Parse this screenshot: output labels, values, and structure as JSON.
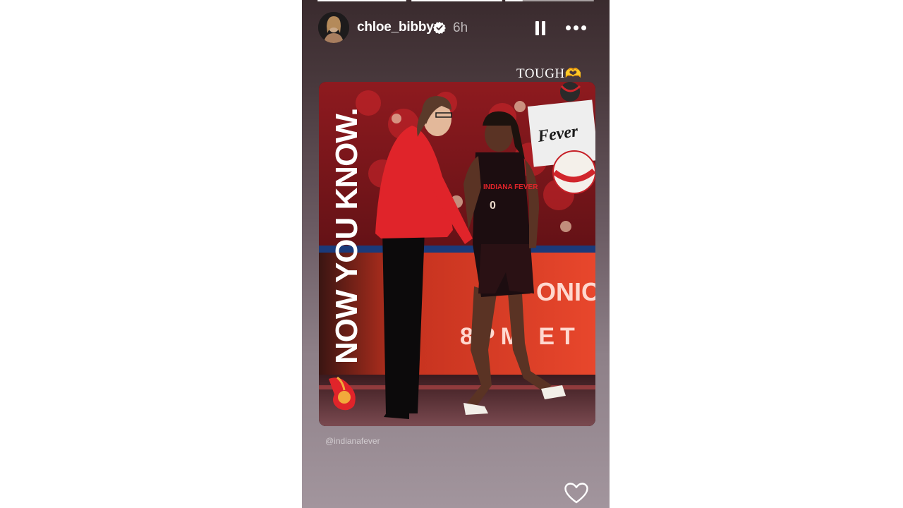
{
  "story": {
    "progress": [
      1,
      1,
      0.2
    ],
    "username": "chloe_bibby",
    "timestamp": "6h",
    "verified": true,
    "caption": "TOUGH🫶",
    "mention": "@indianafever",
    "post": {
      "headline": "NOW YOU KNOW.",
      "jersey_text": "INDIANA FEVER",
      "jersey_number": "0",
      "sticker_text": "Fever",
      "arena_text_line1": "ONIC",
      "arena_text_line2": "8PM ET"
    }
  },
  "icons": {
    "pause": "pause-icon",
    "more": "more-options-icon",
    "like": "heart-icon",
    "verified": "verified-badge-icon"
  }
}
